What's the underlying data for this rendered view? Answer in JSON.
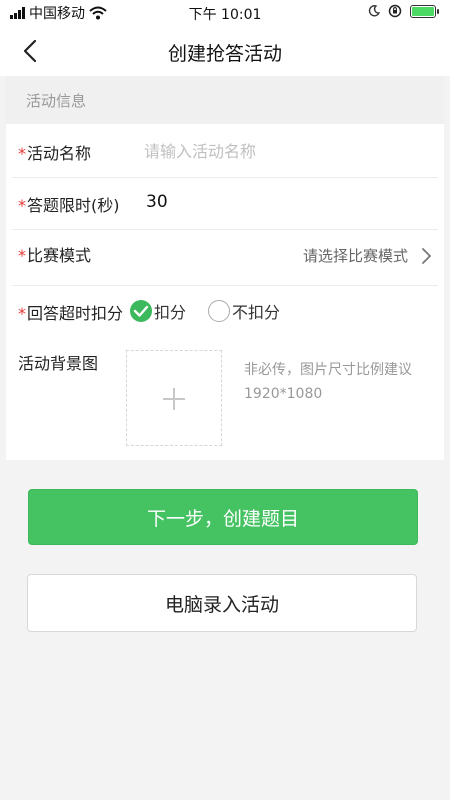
{
  "status_bar": {
    "carrier": "中国移动",
    "time": "下午 10:01"
  },
  "nav": {
    "title": "创建抢答活动"
  },
  "section": {
    "title": "活动信息"
  },
  "form": {
    "name": {
      "required": "*",
      "label": "活动名称",
      "placeholder": "请输入活动名称"
    },
    "time_limit": {
      "required": "*",
      "label": "答题限时(秒)",
      "value": "30"
    },
    "mode": {
      "required": "*",
      "label": "比赛模式",
      "placeholder": "请选择比赛模式"
    },
    "timeout": {
      "required": "*",
      "label": "回答超时扣分",
      "options": [
        {
          "label": "扣分",
          "selected": true
        },
        {
          "label": "不扣分",
          "selected": false
        }
      ]
    },
    "background": {
      "label": "活动背景图",
      "hint_line1": "非必传，图片尺寸比例建议",
      "hint_line2": "1920*1080"
    }
  },
  "buttons": {
    "next": "下一步，创建题目",
    "pc_entry": "电脑录入活动"
  },
  "icons": {
    "back": "chevron-left-icon",
    "wifi": "wifi-icon",
    "signal": "signal-icon",
    "moon": "moon-icon",
    "lock": "rotation-lock-icon",
    "battery": "battery-charging-icon",
    "chevron": "chevron-right-icon",
    "check": "check-icon",
    "add": "plus-icon"
  },
  "colors": {
    "primary": "#45c262",
    "required": "#e53935",
    "battery": "#4cd964"
  }
}
